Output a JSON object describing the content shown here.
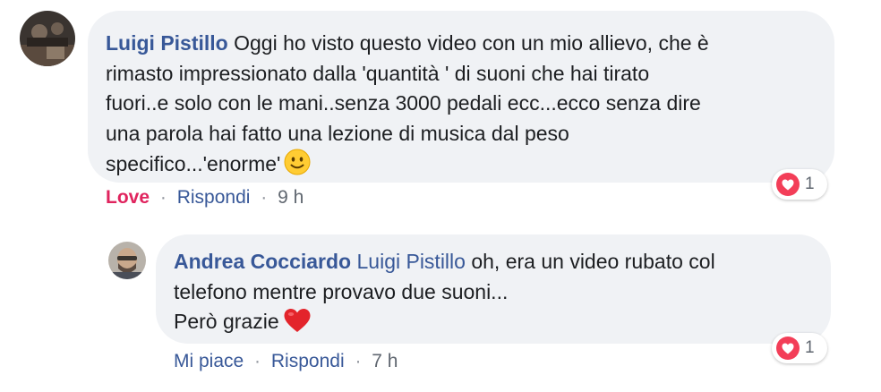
{
  "comment": {
    "author": "Luigi Pistillo",
    "lines": [
      "Oggi ho visto questo video con un mio allievo, che è",
      "rimasto impressionato dalla 'quantità ' di suoni che hai tirato",
      "fuori..e solo con le mani..senza 3000 pedali ecc...ecco senza dire",
      "una parola hai fatto una lezione di musica dal peso",
      "specifico...'enorme'"
    ],
    "emoji": "slightly-smiling-face",
    "reaction_icon": "heart-icon",
    "reaction_count": "1",
    "actions": {
      "reaction_label": "Love",
      "reply_label": "Rispondi",
      "time": "9 h"
    }
  },
  "reply": {
    "author": "Andrea Cocciardo",
    "mention": "Luigi Pistillo",
    "lines": [
      "oh, era un video rubato col",
      "telefono mentre provavo due suoni...",
      "Però grazie"
    ],
    "emoji": "red-heart",
    "reaction_icon": "heart-icon",
    "reaction_count": "1",
    "actions": {
      "like_label": "Mi piace",
      "reply_label": "Rispondi",
      "time": "7 h"
    }
  },
  "colors": {
    "link": "#385898",
    "love": "#e0245e",
    "bubble": "#f0f2f5",
    "muted": "#606770"
  }
}
